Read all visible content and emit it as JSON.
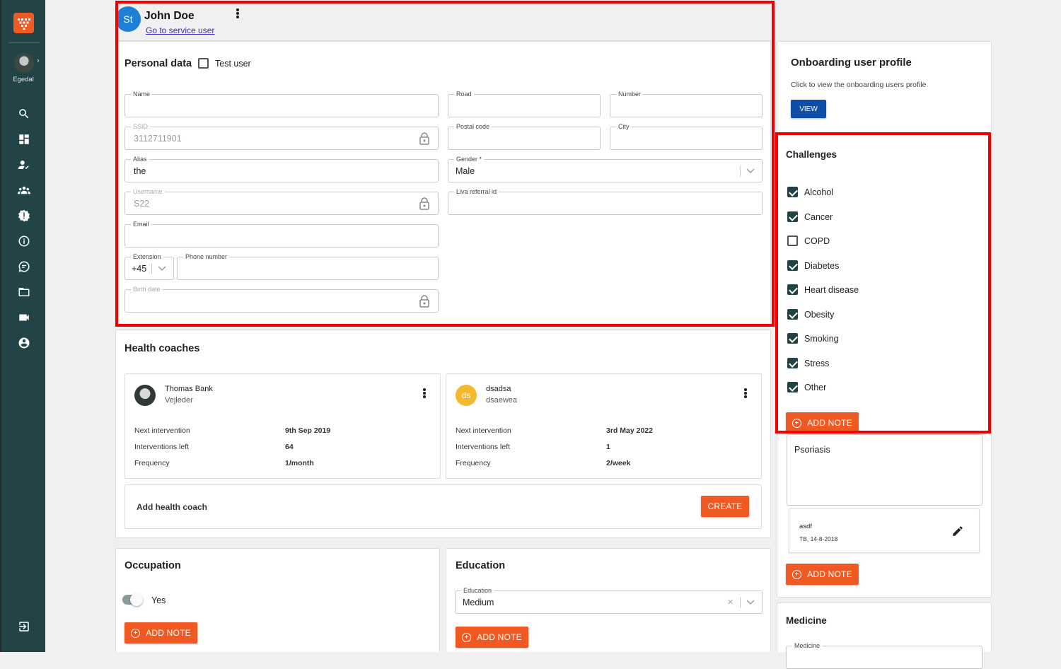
{
  "sidebar": {
    "org_name": "Egedal"
  },
  "header": {
    "avatar_initials": "St",
    "user_name": "John Doe",
    "service_link": "Go to service user"
  },
  "personal_data": {
    "title": "Personal data",
    "test_user_label": "Test user",
    "test_user_checked": false,
    "fields": {
      "name": {
        "label": "Name",
        "value": ""
      },
      "ssid": {
        "label": "SSID",
        "value": "3112711901"
      },
      "alias": {
        "label": "Alias",
        "value": "the"
      },
      "username": {
        "label": "Username",
        "value": "S22"
      },
      "email": {
        "label": "Email",
        "value": ""
      },
      "extension": {
        "label": "Extension",
        "value": "+45"
      },
      "phone": {
        "label": "Phone number",
        "value": ""
      },
      "birth_date": {
        "label": "Birth date",
        "value": ""
      },
      "road": {
        "label": "Road",
        "value": ""
      },
      "number": {
        "label": "Number",
        "value": ""
      },
      "postal_code": {
        "label": "Postal code",
        "value": ""
      },
      "city": {
        "label": "City",
        "value": ""
      },
      "gender": {
        "label": "Gender *",
        "value": "Male"
      },
      "liva_referral": {
        "label": "Liva referral id",
        "value": ""
      }
    }
  },
  "health_coaches": {
    "title": "Health coaches",
    "coaches": [
      {
        "name": "Thomas Bank",
        "role": "Vejleder",
        "next_label": "Next intervention",
        "next_value": "9th Sep 2019",
        "left_label": "Interventions left",
        "left_value": "64",
        "freq_label": "Frequency",
        "freq_value": "1/month"
      },
      {
        "initials": "ds",
        "name": "dsadsa",
        "role": "dsaewea",
        "next_label": "Next intervention",
        "next_value": "3rd May 2022",
        "left_label": "Interventions left",
        "left_value": "1",
        "freq_label": "Frequency",
        "freq_value": "2/week"
      }
    ],
    "add_label": "Add health coach",
    "create_button": "CREATE"
  },
  "occupation": {
    "title": "Occupation",
    "toggle_label": "Yes",
    "add_note": "ADD NOTE"
  },
  "education": {
    "title": "Education",
    "field_label": "Education",
    "value": "Medium",
    "add_note": "ADD NOTE"
  },
  "onboarding": {
    "title": "Onboarding user profile",
    "description": "Click to view the onboarding users profile",
    "view_button": "VIEW"
  },
  "challenges": {
    "title": "Challenges",
    "items": [
      {
        "label": "Alcohol",
        "checked": true
      },
      {
        "label": "Cancer",
        "checked": true
      },
      {
        "label": "COPD",
        "checked": false
      },
      {
        "label": "Diabetes",
        "checked": true
      },
      {
        "label": "Heart disease",
        "checked": true
      },
      {
        "label": "Obesity",
        "checked": true
      },
      {
        "label": "Smoking",
        "checked": true
      },
      {
        "label": "Stress",
        "checked": true
      },
      {
        "label": "Other",
        "checked": true
      }
    ],
    "add_note": "ADD NOTE",
    "note_text": "Psoriasis",
    "saved_note": {
      "text": "asdf",
      "meta": "TB, 14-8-2018"
    },
    "add_note_2": "ADD NOTE"
  },
  "medicine": {
    "title": "Medicine",
    "field_label": "Medicine"
  },
  "colors": {
    "sidebar": "#234447",
    "accent": "#f05a22",
    "checkbox": "#1f4446",
    "view_button": "#0d4ea6",
    "avatar_blue": "#1e7fd6",
    "avatar_yellow": "#f5b82e",
    "highlight": "#f20000"
  }
}
